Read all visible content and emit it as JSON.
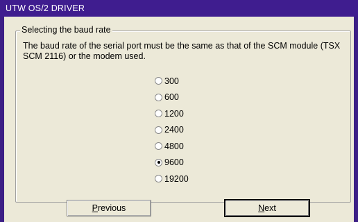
{
  "window": {
    "title": "UTW OS/2 DRIVER"
  },
  "group": {
    "legend": "Selecting the baud rate",
    "description": "The baud rate of the serial port must be the same as that of the SCM module (TSX SCM 2116) or the modem used."
  },
  "baud_rates": [
    {
      "label": "300",
      "checked": false
    },
    {
      "label": "600",
      "checked": false
    },
    {
      "label": "1200",
      "checked": false
    },
    {
      "label": "2400",
      "checked": false
    },
    {
      "label": "4800",
      "checked": false
    },
    {
      "label": "9600",
      "checked": true
    },
    {
      "label": "19200",
      "checked": false
    }
  ],
  "buttons": {
    "previous_label": "Previous",
    "next_label": "Next"
  },
  "colors": {
    "titlebar": "#3f1d8f",
    "frame": "#3c1f86",
    "dialog_bg": "#ece9d8"
  }
}
